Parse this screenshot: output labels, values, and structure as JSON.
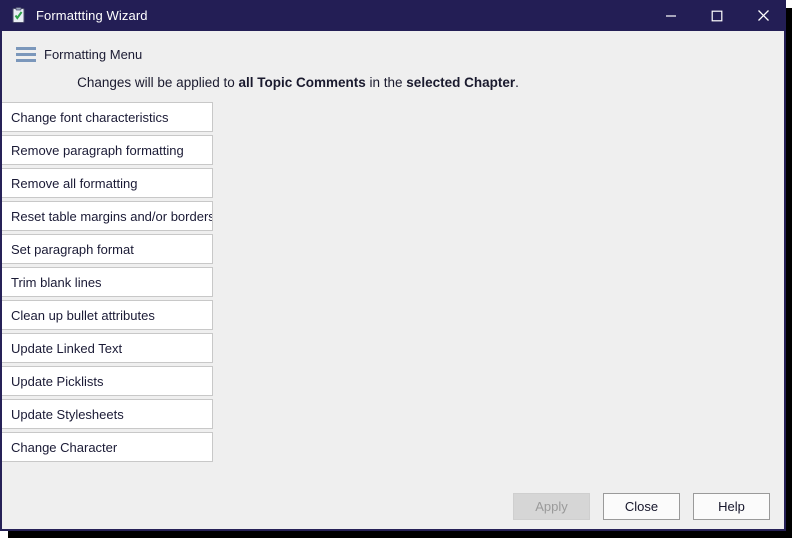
{
  "window": {
    "title": "Formattting Wizard",
    "app_icon": "clipboard-check-icon",
    "titlebar_color": "#231e55",
    "border_color": "#262157",
    "body_color": "#efefef",
    "controls": {
      "minimize": "minimize-icon",
      "maximize": "maximize-icon",
      "close": "close-icon"
    }
  },
  "menu": {
    "icon": "hamburger-menu-icon",
    "label": "Formatting Menu",
    "icon_color": "#7b97bb"
  },
  "notice": {
    "part1": "Changes will be applied to ",
    "bold1": "all Topic Comments",
    "part2": " in the ",
    "bold2": "selected Chapter",
    "part3": "."
  },
  "actions": [
    {
      "label": "Change font characteristics"
    },
    {
      "label": "Remove paragraph formatting"
    },
    {
      "label": "Remove all formatting"
    },
    {
      "label": "Reset table margins and/or borders"
    },
    {
      "label": "Set paragraph format"
    },
    {
      "label": "Trim blank lines"
    },
    {
      "label": "Clean up bullet attributes"
    },
    {
      "label": "Update Linked Text"
    },
    {
      "label": "Update Picklists"
    },
    {
      "label": "Update Stylesheets"
    },
    {
      "label": "Change Character"
    }
  ],
  "footer": {
    "apply": {
      "label": "Apply",
      "enabled": false
    },
    "close": {
      "label": "Close",
      "enabled": true
    },
    "help": {
      "label": "Help",
      "enabled": true
    }
  }
}
